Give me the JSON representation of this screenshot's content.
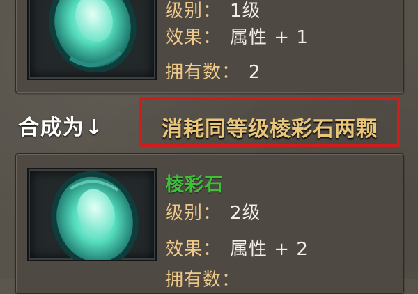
{
  "top_item": {
    "level_label": "级别：",
    "level_value": "1级",
    "effect_label": "效果：",
    "effect_value": "属性 + 1",
    "owned_label": "拥有数：",
    "owned_value": "2"
  },
  "compose": {
    "label": "合成为",
    "arrow": "↓",
    "hint": "消耗同等级棱彩石两颗"
  },
  "bottom_item": {
    "name": "棱彩石",
    "level_label": "级别：",
    "level_value": "2级",
    "effect_label": "效果：",
    "effect_value": "属性 + 2",
    "owned_label": "拥有数："
  },
  "colors": {
    "highlight_border": "#d11c1c",
    "item_name": "#3fbf3a",
    "label": "#efc98a",
    "gem": "#4ed6b6"
  },
  "icons": [
    "prismatic-gem-icon",
    "down-arrow-icon"
  ]
}
